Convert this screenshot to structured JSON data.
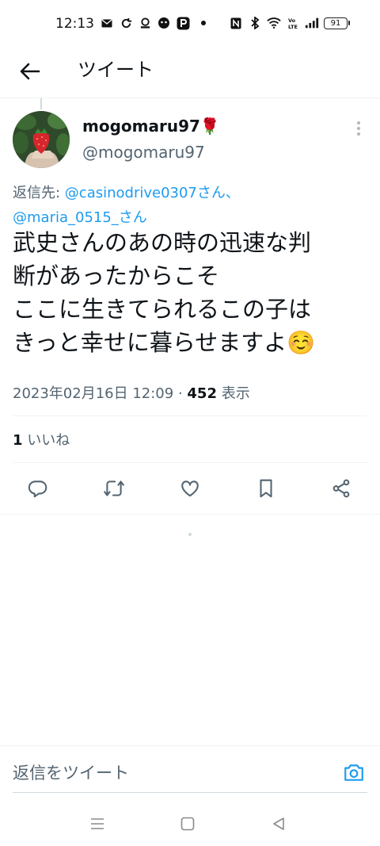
{
  "status_bar": {
    "time": "12:13",
    "battery": "91"
  },
  "header": {
    "title": "ツイート"
  },
  "tweet": {
    "display_name": "mogomaru97",
    "name_emoji": "🌹",
    "handle": "@mogomaru97",
    "reply_to_prefix": "返信先: ",
    "reply_to_mentions": [
      "@casinodrive0307さん、",
      "@maria_0515_さん"
    ],
    "text_lines": [
      "武史さんのあの時の迅速な判",
      "断があったからこそ",
      "ここに生きてられるこの子は",
      "きっと幸せに暮らせますよ☺️"
    ],
    "timestamp": "2023年02月16日 12:09",
    "separator": " · ",
    "view_count": "452",
    "view_label": " 表示",
    "like_count": "1",
    "like_label": " いいね"
  },
  "reply_bar": {
    "placeholder": "返信をツイート"
  },
  "colors": {
    "accent": "#1d9bf0",
    "secondary_text": "#536471",
    "primary_text": "#0f1419",
    "divider": "#eff3f4"
  }
}
